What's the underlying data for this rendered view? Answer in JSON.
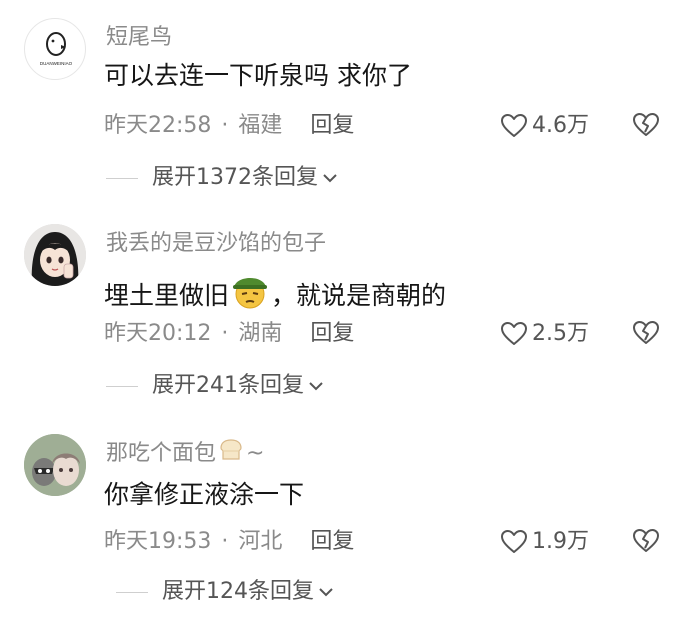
{
  "comments": [
    {
      "username": "短尾鸟",
      "avatar_logo_text": "DUANWEINIAO",
      "content_before": "可以去连一下听泉吗 求你了",
      "content_after": "",
      "time": "昨天22:58",
      "location": "福建",
      "reply_label": "回复",
      "likes": "4.6万",
      "expand_label": "展开1372条回复"
    },
    {
      "username": "我丢的是豆沙馅的包子",
      "content_before": "埋土里做旧",
      "emoji": "green-hat-emoji",
      "content_after": "，就说是商朝的",
      "time": "昨天20:12",
      "location": "湖南",
      "reply_label": "回复",
      "likes": "2.5万",
      "expand_label": "展开241条回复"
    },
    {
      "username": "那吃个面包",
      "username_suffix": "~",
      "username_emoji": "bread-emoji",
      "content_before": "你拿修正液涂一下",
      "content_after": "",
      "time": "昨天19:53",
      "location": "河北",
      "reply_label": "回复",
      "likes": "1.9万",
      "expand_label": "展开124条回复"
    }
  ],
  "separator": "·",
  "icons": {
    "like": "heart-outline-icon",
    "dislike": "broken-heart-icon",
    "expand": "chevron-down-icon"
  },
  "colors": {
    "text_primary": "#161616",
    "text_secondary": "#8a8a8a",
    "hat_green": "#4f8a2e",
    "face_yellow": "#f4c542"
  }
}
